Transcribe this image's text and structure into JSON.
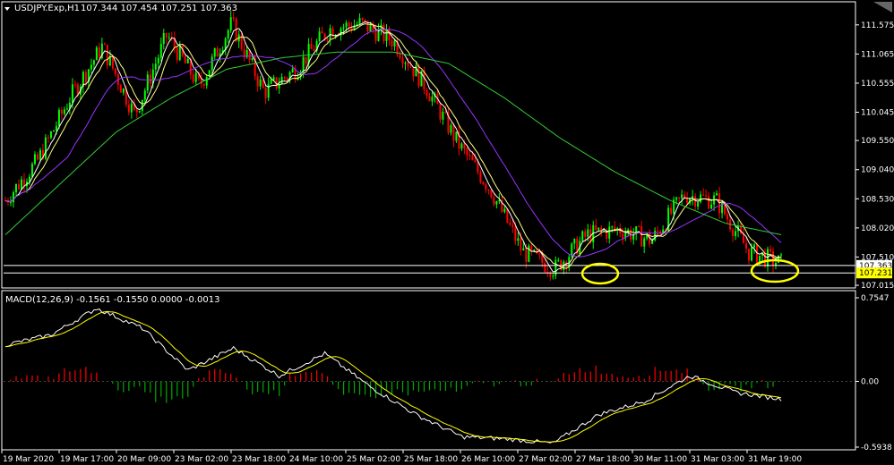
{
  "main_chart": {
    "symbol_label": "USDJPY.Exp,H1",
    "ohlc_label": "107.344 107.454 107.251 107.363",
    "y_ticks": [
      "111.575",
      "111.065",
      "110.555",
      "110.045",
      "109.550",
      "109.040",
      "108.530",
      "108.020",
      "107.510",
      "107.015"
    ],
    "price_bid": "107.363",
    "price_ask": "107.231"
  },
  "macd_panel": {
    "label": "MACD(12,26,9) -0.1561 -0.1550 0.0000 -0.0013",
    "y_ticks": [
      "0.7547",
      "0.00",
      "-0.5938"
    ]
  },
  "x_ticks": [
    "19 Mar 2020",
    "19 Mar 17:00",
    "20 Mar 09:00",
    "23 Mar 02:00",
    "23 Mar 18:00",
    "24 Mar 10:00",
    "25 Mar 02:00",
    "25 Mar 18:00",
    "26 Mar 10:00",
    "27 Mar 02:00",
    "27 Mar 18:00",
    "30 Mar 11:00",
    "31 Mar 03:00",
    "31 Mar 19:00"
  ],
  "colors": {
    "background": "#000000",
    "bull_candle": "#00ff00",
    "bear_candle": "#ff0000",
    "ma_fast": "#ffffff",
    "ma_mid": "#ffff80",
    "ma_slow": "#9933ff",
    "ma_long": "#33cc33",
    "macd_line": "#ffffff",
    "signal_line": "#ffff00",
    "hist_up": "#ff0000",
    "hist_down": "#00aa00",
    "highlight_circle": "#ffff00"
  },
  "chart_data": [
    {
      "type": "candlestick",
      "title": "USDJPY.Exp,H1",
      "ylim": [
        107.0,
        111.76
      ],
      "x_labels": [
        "19 Mar 2020",
        "19 Mar 17:00",
        "20 Mar 09:00",
        "23 Mar 02:00",
        "23 Mar 18:00",
        "24 Mar 10:00",
        "25 Mar 02:00",
        "25 Mar 18:00",
        "26 Mar 10:00",
        "27 Mar 02:00",
        "27 Mar 18:00",
        "30 Mar 11:00",
        "31 Mar 03:00",
        "31 Mar 19:00"
      ],
      "close_path": [
        108.5,
        109.2,
        110.3,
        111.2,
        110.0,
        111.4,
        110.5,
        111.6,
        110.4,
        110.8,
        111.5,
        111.6,
        111.3,
        110.5,
        109.5,
        108.7,
        107.6,
        107.3,
        107.9,
        108.0,
        107.8,
        108.6,
        108.5,
        107.6,
        107.4
      ],
      "ma_long_path": [
        107.9,
        108.8,
        109.7,
        110.3,
        110.8,
        111.0,
        111.1,
        111.1,
        110.9,
        110.3,
        109.6,
        109.0,
        108.5,
        108.1,
        107.9
      ],
      "last_price": 107.363,
      "bid_line": 107.363,
      "ask_line": 107.231
    },
    {
      "type": "histogram-line",
      "title": "MACD(12,26,9)",
      "values": {
        "macd": -0.1561,
        "signal": -0.155,
        "hist_a": 0.0,
        "hist_b": -0.0013
      },
      "ylim": [
        -0.5938,
        0.7547
      ],
      "macd_path": [
        0.33,
        0.42,
        0.66,
        0.48,
        0.1,
        0.3,
        0.05,
        0.25,
        -0.05,
        -0.3,
        -0.5,
        -0.52,
        -0.56,
        -0.3,
        -0.18,
        0.05,
        -0.1,
        -0.16
      ],
      "signal_path": [
        0.3,
        0.45,
        0.6,
        0.4,
        0.2,
        0.15,
        0.1,
        0.2,
        0.0,
        -0.25,
        -0.45,
        -0.5,
        -0.5,
        -0.35,
        -0.15,
        0.05,
        -0.05,
        -0.16
      ]
    }
  ]
}
